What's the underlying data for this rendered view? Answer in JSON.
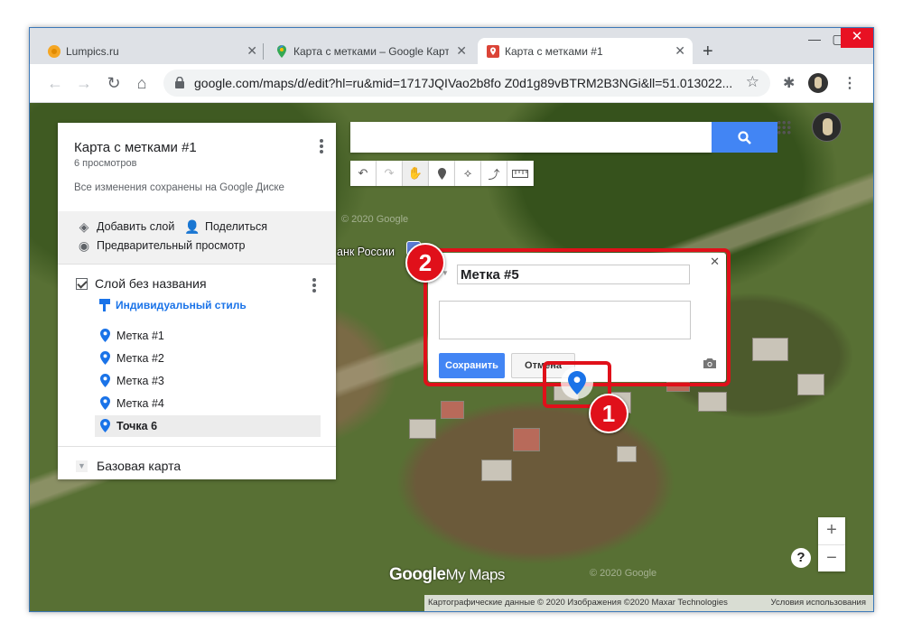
{
  "browser": {
    "tabs": [
      {
        "title": "Lumpics.ru",
        "favicon": "orange-circle-icon"
      },
      {
        "title": "Карта с метками – Google Карты",
        "favicon": "google-maps-icon"
      },
      {
        "title": "Карта с метками #1",
        "favicon": "red-pin-icon",
        "active": true
      }
    ],
    "url": "google.com/maps/d/edit?hl=ru&mid=1717JQIVao2b8fo Z0d1g89vBTRM2B3NGi&ll=51.013022..."
  },
  "panel": {
    "title": "Карта с метками #1",
    "views": "6 просмотров",
    "saved_status": "Все изменения сохранены на Google Диске",
    "add_layer": "Добавить слой",
    "share": "Поделиться",
    "preview": "Предварительный просмотр",
    "layer_name": "Слой без названия",
    "style": "Индивидуальный стиль",
    "items": [
      "Метка #1",
      "Метка #2",
      "Метка #3",
      "Метка #4",
      "Точка 6"
    ],
    "selected_item": "Точка 6",
    "base_map": "Базовая карта"
  },
  "map": {
    "place_label": "анк России",
    "watermark_1": "© 2020 Google",
    "watermark_2": "© 2020 Google",
    "logo_google": "Google",
    "logo_mymaps": "My Maps",
    "attribution": "Картографические данные © 2020 Изображения ©2020 Maxar Technologies",
    "terms": "Условия использования",
    "help": "?",
    "zoom_in": "+",
    "zoom_out": "−"
  },
  "infowindow": {
    "name_value": "Метка #5",
    "description_value": "",
    "save": "Сохранить",
    "cancel": "Отмена"
  },
  "annotations": {
    "step1": "1",
    "step2": "2"
  },
  "colors": {
    "accent": "#4285f4",
    "pin": "#1a73e8",
    "highlight": "#e0101a"
  }
}
